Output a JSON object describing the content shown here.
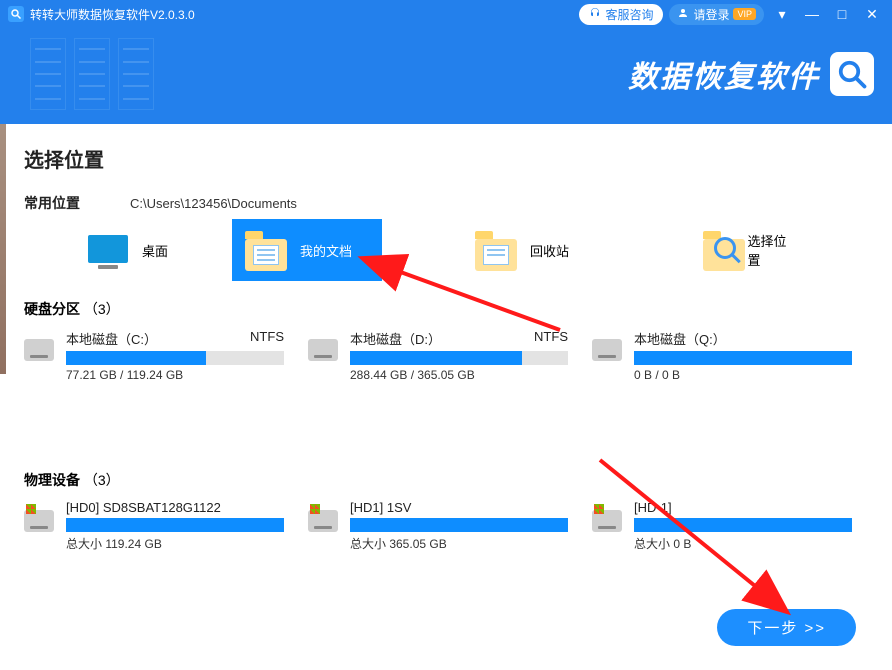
{
  "titlebar": {
    "title": "转转大师数据恢复软件V2.0.3.0",
    "service_label": "客服咨询",
    "login_label": "请登录",
    "vip": "VIP"
  },
  "brand": "数据恢复软件",
  "section_title": "选择位置",
  "common": {
    "title": "常用位置",
    "path": "C:\\Users\\123456\\Documents",
    "items": [
      {
        "label": "桌面"
      },
      {
        "label": "我的文档"
      },
      {
        "label": "回收站"
      },
      {
        "label": "选择位置"
      }
    ]
  },
  "partitions": {
    "title": "硬盘分区",
    "count": "（3）",
    "items": [
      {
        "name": "本地磁盘（C:）",
        "fs": "NTFS",
        "used_pct": 64,
        "size": "77.21 GB / 119.24 GB"
      },
      {
        "name": "本地磁盘（D:）",
        "fs": "NTFS",
        "used_pct": 79,
        "size": "288.44 GB / 365.05 GB"
      },
      {
        "name": "本地磁盘（Q:）",
        "fs": "",
        "used_pct": 100,
        "size": "0 B / 0 B"
      }
    ]
  },
  "devices": {
    "title": "物理设备",
    "count": "（3）",
    "size_prefix": "总大小 ",
    "items": [
      {
        "name": "[HD0] SD8SBAT128G1122",
        "size": "119.24 GB"
      },
      {
        "name": "[HD1] 1SV",
        "size": "365.05 GB"
      },
      {
        "name": "[HD-1]",
        "size": "0 B"
      }
    ]
  },
  "next_label": "下一步 >>"
}
